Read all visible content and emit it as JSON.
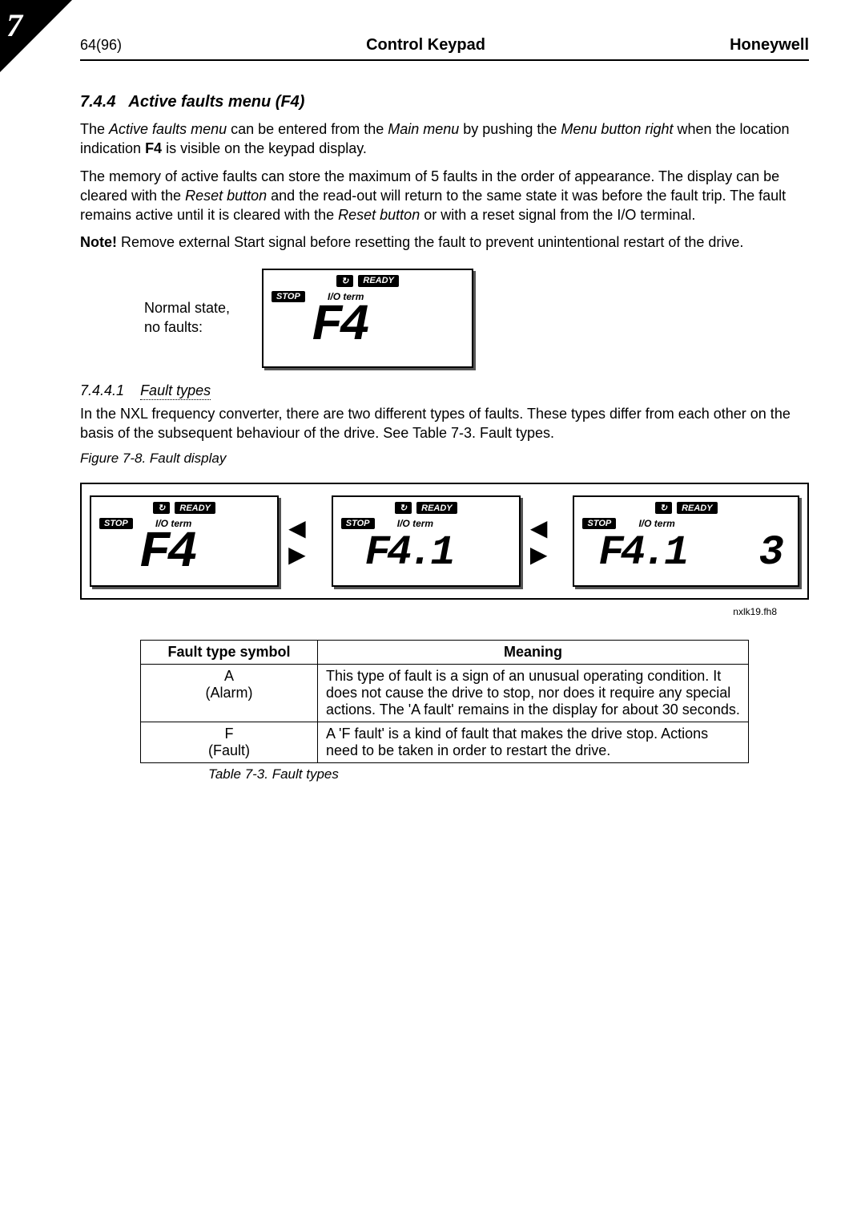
{
  "corner_number": "7",
  "header": {
    "left": "64(96)",
    "center": "Control Keypad",
    "right": "Honeywell"
  },
  "sec_744": {
    "number": "7.4.4",
    "title": "Active faults menu (F4)"
  },
  "para1_a": "The ",
  "para1_b": "Active faults menu",
  "para1_c": " can be entered from the ",
  "para1_d": "Main menu",
  "para1_e": " by pushing the ",
  "para1_f": "Menu button right",
  "para1_g": " when the location indication ",
  "para1_h": "F4",
  "para1_i": " is visible on the keypad display.",
  "para2_a": "The memory of active faults can store the maximum of 5 faults in the order of appearance. The display can be cleared with the ",
  "para2_b": "Reset button",
  "para2_c": " and the read-out will return to the same state it was before the fault trip. The fault remains active until it is cleared with the ",
  "para2_d": "Reset button",
  "para2_e": " or with a reset signal from the I/O terminal.",
  "note_label": "Note!",
  "note_text": " Remove external Start signal before resetting the fault to prevent unintentional restart of the drive.",
  "lcd": {
    "label_line1": "Normal state,",
    "label_line2": "no faults:",
    "ready": "READY",
    "stop": "STOP",
    "io": "I/O term",
    "seg_main": "F4",
    "seg_a": "F4",
    "seg_b": "F4.1",
    "seg_c": "F4.1",
    "seg_c_right": "3"
  },
  "sec_7441": {
    "number": "7.4.4.1",
    "title": "Fault types"
  },
  "para3": "In the NXL frequency converter, there are two different types of faults. These types differ from each other on the basis of the subsequent behaviour of the drive. See Table 7-3. Fault types.",
  "fig_caption": "Figure 7-8. Fault display",
  "small_id": "nxlk19.fh8",
  "arrows": "◀ ▶",
  "table": {
    "head_sym": "Fault type symbol",
    "head_mean": "Meaning",
    "rows": [
      {
        "sym1": "A",
        "sym2": "(Alarm)",
        "mean": "This type of fault is a sign of an unusual operating condition. It does not cause the drive to stop, nor does it require any special actions. The 'A fault' remains in the display for about 30 seconds."
      },
      {
        "sym1": "F",
        "sym2": "(Fault)",
        "mean": "A 'F fault' is a kind of fault that makes the drive stop. Actions need to be taken in order to restart the drive."
      }
    ]
  },
  "table_caption": "Table 7-3. Fault types"
}
